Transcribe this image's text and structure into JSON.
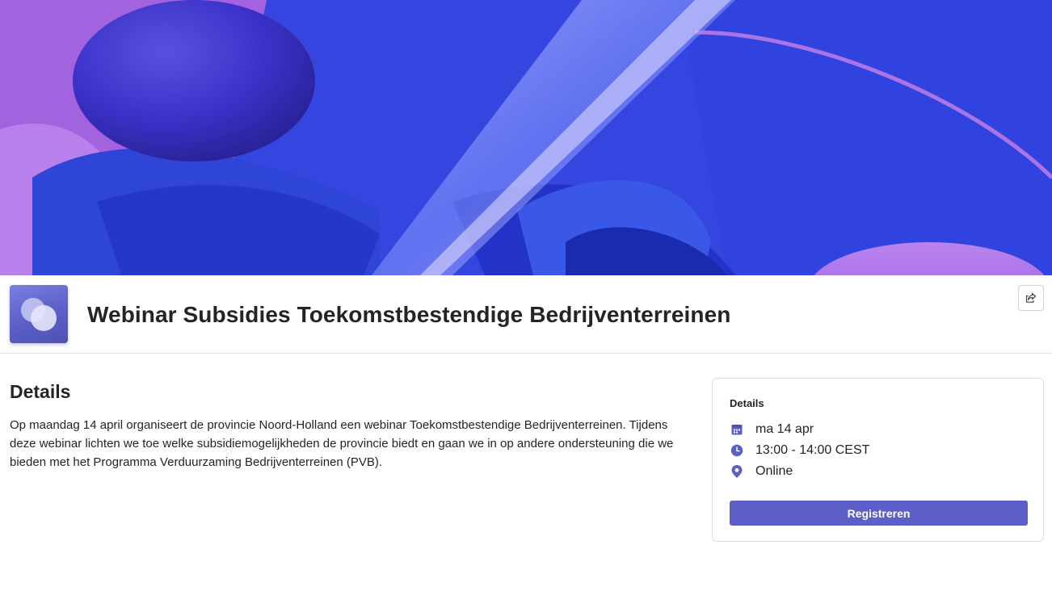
{
  "banner": {
    "alt": "Abstract purple and blue 3D shapes"
  },
  "header": {
    "title": "Webinar Subsidies Toekomstbestendige Bedrijventerreinen",
    "share_icon": "share-icon"
  },
  "main": {
    "heading": "Details",
    "description": "Op maandag 14 april organiseert de provincie Noord-Holland een webinar Toekomstbestendige Bedrijventerreinen. Tijdens deze webinar lichten we toe welke subsidiemogelijkheden de provincie biedt en gaan we in op andere ondersteuning die we bieden met het Programma Verduurzaming Bedrijventerreinen (PVB)."
  },
  "card": {
    "title": "Details",
    "date": "ma 14 apr",
    "time": "13:00 - 14:00 CEST",
    "location": "Online",
    "register_label": "Registreren"
  },
  "colors": {
    "accent": "#5b5fc7",
    "text": "#242424",
    "border": "#e0e0e0"
  }
}
